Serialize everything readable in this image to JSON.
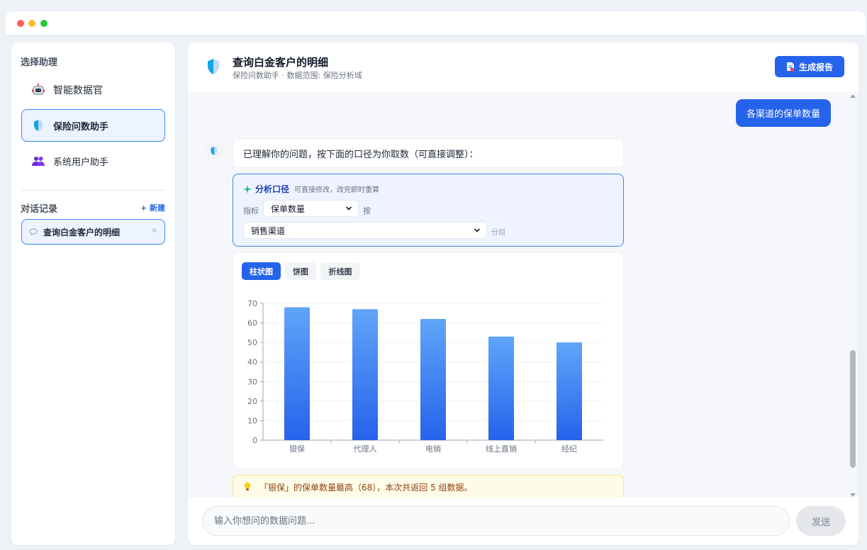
{
  "sidebar": {
    "assistants_heading": "选择助理",
    "assistants": [
      {
        "label": "智能数据官",
        "icon": "robot-icon",
        "active": false
      },
      {
        "label": "保险问数助手",
        "icon": "shield-icon",
        "active": true
      },
      {
        "label": "系统用户助手",
        "icon": "users-icon",
        "active": false
      }
    ],
    "history_heading": "对话记录",
    "new_label": "+ 新建",
    "conversations": [
      {
        "label": "查询白金客户的明细",
        "close": "×"
      }
    ]
  },
  "header": {
    "title": "查询白金客户的明细",
    "subtitle": "保险问数助手 · 数据范围: 保险分析域",
    "report_button": "生成报告"
  },
  "chat": {
    "user_message": "各渠道的保单数量",
    "bot_message": "已理解你的问题，按下面的口径为你取数（可直接调整）：",
    "caliber": {
      "title": "分析口径",
      "hint": "可直接修改，改完即时重算",
      "metric_label": "指标",
      "metric_value": "保单数量",
      "by_label": "按",
      "group_value": "销售渠道",
      "group_label": "分组"
    },
    "tabs": [
      "柱状图",
      "饼图",
      "折线图"
    ],
    "active_tab": 0,
    "tip": "「银保」的保单数量最高（68），本次共返回 5 组数据。"
  },
  "input": {
    "placeholder": "输入你想问的数据问题...",
    "send_label": "发送"
  },
  "colors": {
    "accent": "#2563eb",
    "bar_top": "#60a5fa",
    "bar_bottom": "#2563eb"
  },
  "chart_data": {
    "type": "bar",
    "categories": [
      "银保",
      "代理人",
      "电销",
      "线上直销",
      "经纪"
    ],
    "values": [
      68,
      67,
      62,
      53,
      50
    ],
    "ylim": [
      0,
      70
    ],
    "yticks": [
      0,
      10,
      20,
      30,
      40,
      50,
      60,
      70
    ],
    "grid": true
  }
}
